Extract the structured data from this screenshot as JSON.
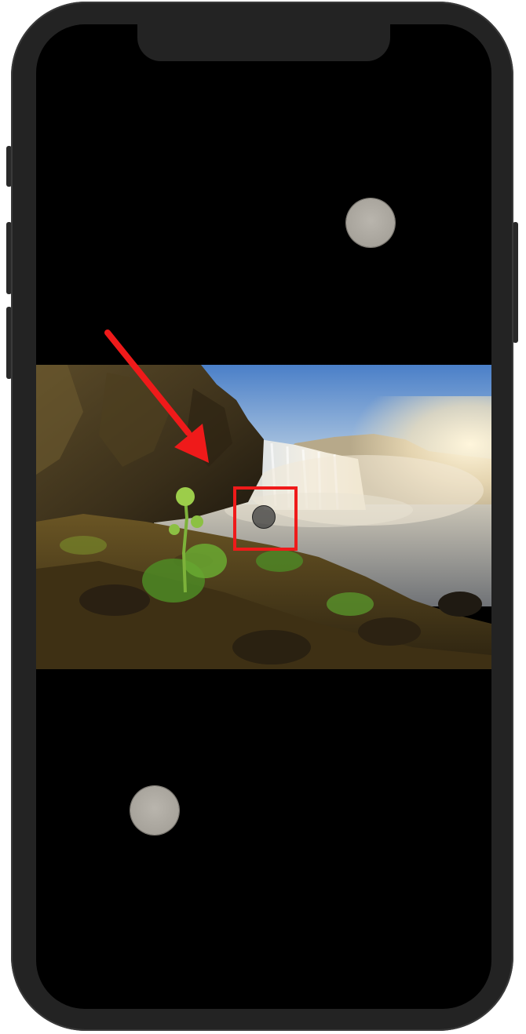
{
  "device": {
    "frame_color": "#232323",
    "screen_color": "#000000",
    "highlight_color": "#ef1a1a",
    "touch_color": "#aaa69e"
  },
  "screen": {
    "photo": {
      "subject": "waterfall-landscape"
    },
    "touch_points": [
      {
        "name": "touch-indicator-top"
      },
      {
        "name": "touch-indicator-bottom"
      }
    ],
    "annotation": {
      "arrow": "red-arrow-icon",
      "box": "red-highlight-box"
    }
  }
}
